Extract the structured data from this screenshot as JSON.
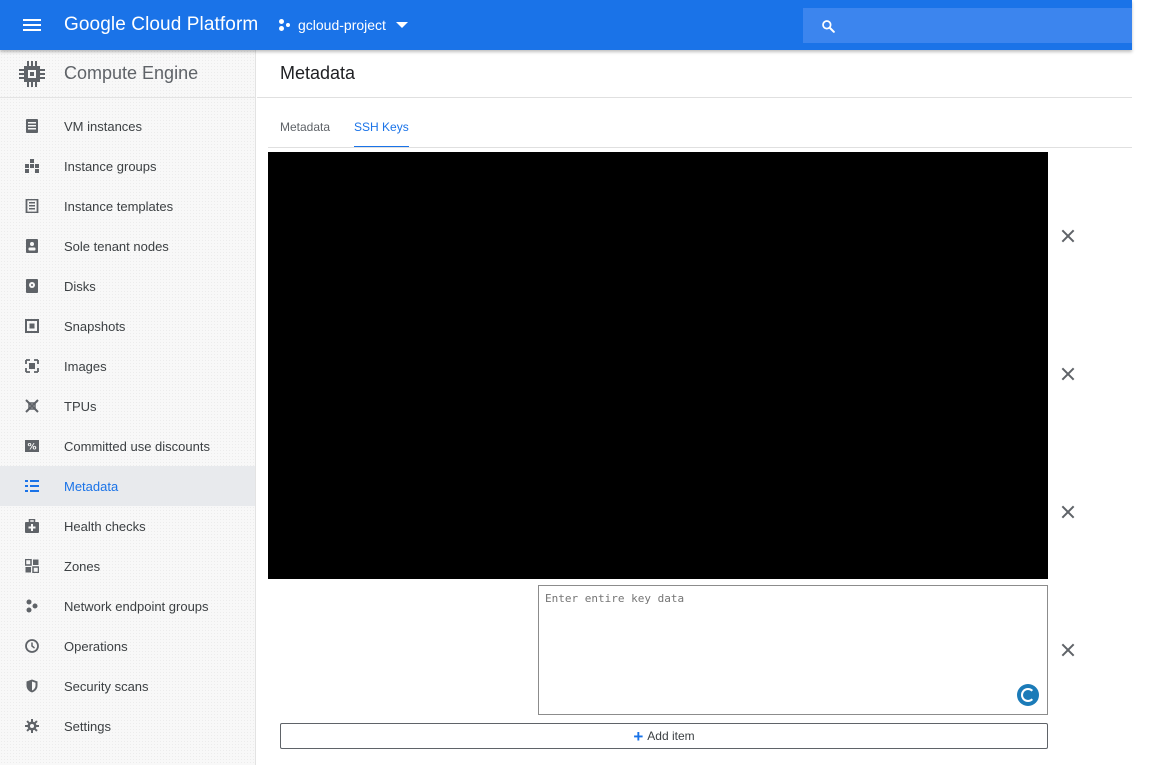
{
  "topbar": {
    "brand": "Google Cloud Platform",
    "project": "gcloud-project",
    "menu_icon": "hamburger-menu-icon",
    "search_icon": "search-icon",
    "color": "#1a73e8"
  },
  "sidebar": {
    "product": "Compute Engine",
    "items": [
      {
        "label": "VM instances",
        "icon": "vm-instances-icon"
      },
      {
        "label": "Instance groups",
        "icon": "instance-groups-icon"
      },
      {
        "label": "Instance templates",
        "icon": "instance-templates-icon"
      },
      {
        "label": "Sole tenant nodes",
        "icon": "sole-tenant-icon"
      },
      {
        "label": "Disks",
        "icon": "disk-icon"
      },
      {
        "label": "Snapshots",
        "icon": "snapshot-icon"
      },
      {
        "label": "Images",
        "icon": "images-icon"
      },
      {
        "label": "TPUs",
        "icon": "tpu-icon"
      },
      {
        "label": "Committed use discounts",
        "icon": "percent-icon"
      },
      {
        "label": "Metadata",
        "icon": "list-icon",
        "active": true
      },
      {
        "label": "Health checks",
        "icon": "medkit-icon"
      },
      {
        "label": "Zones",
        "icon": "zones-icon"
      },
      {
        "label": "Network endpoint groups",
        "icon": "dots-icon"
      },
      {
        "label": "Operations",
        "icon": "clock-icon"
      },
      {
        "label": "Security scans",
        "icon": "shield-icon"
      },
      {
        "label": "Settings",
        "icon": "gear-icon"
      }
    ]
  },
  "main": {
    "title": "Metadata",
    "tabs": [
      {
        "label": "Metadata",
        "active": false
      },
      {
        "label": "SSH Keys",
        "active": true
      }
    ],
    "key_input": {
      "placeholder": "Enter entire key data",
      "value": ""
    },
    "add_item_label": "Add item"
  }
}
